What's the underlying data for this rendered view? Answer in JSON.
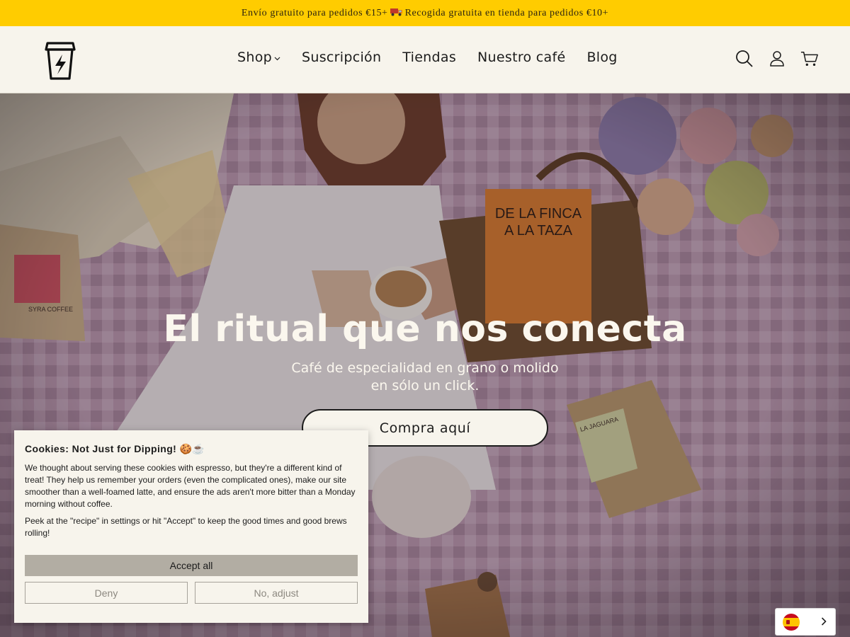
{
  "announcement": {
    "part1": "Envío gratuito para pedidos €15+",
    "truck_icon": "truck-icon",
    "part2": "Recogida gratuita en tienda para pedidos €10+"
  },
  "header": {
    "logo_icon": "coffee-cup-lightning-logo",
    "nav": [
      {
        "label": "Shop",
        "has_dropdown": true
      },
      {
        "label": "Suscripción"
      },
      {
        "label": "Tiendas"
      },
      {
        "label": "Nuestro café"
      },
      {
        "label": "Blog"
      }
    ],
    "icons": [
      "search-icon",
      "account-icon",
      "cart-icon"
    ]
  },
  "hero": {
    "title": "El ritual que nos conecta",
    "subtitle_line1": "Café de especialidad en grano o molido",
    "subtitle_line2": "en sólo un click.",
    "button_label": "Compra aquí",
    "image_text": {
      "box": "DE LA FINCA A LA TAZA",
      "bag_right": "LA JAGUARA",
      "brand": "SYRA COFFEE"
    }
  },
  "cookie": {
    "title": "Cookies: Not Just for Dipping! 🍪☕",
    "text1": "We thought about serving these cookies with espresso, but they're a different kind of treat! They help us remember your orders (even the complicated ones), make our site smoother than a well-foamed latte, and ensure the ads aren't more bitter than a Monday morning without coffee.",
    "text2": "Peek at the \"recipe\" in settings or hit \"Accept\" to keep the good times and good brews rolling!",
    "accept_label": "Accept all",
    "deny_label": "Deny",
    "adjust_label": "No, adjust"
  },
  "language": {
    "flag_icon": "spain-flag-icon",
    "chevron_icon": "chevron-right-icon"
  },
  "colors": {
    "announcement_bg": "#ffcc00",
    "header_bg": "#f7f4ec",
    "accept_bg": "#b2ada3"
  }
}
